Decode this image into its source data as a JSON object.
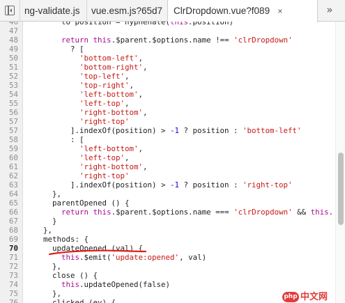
{
  "tabs": [
    {
      "label": "ng-validate.js",
      "active": false
    },
    {
      "label": "vue.esm.js?65d7",
      "active": false
    },
    {
      "label": "ClrDropdown.vue?f089",
      "active": true
    }
  ],
  "tab_close_glyph": "×",
  "more_tabs_glyph": "»",
  "icons": {
    "panel_toggle": "sidebar-toggle-icon",
    "close": "close-icon",
    "more": "chevrons-right-icon"
  },
  "colors": {
    "keyword": "#aa0d91",
    "string": "#c41a16",
    "number": "#1c00cf",
    "annotation": "#e0201c"
  },
  "code_lines": [
    {
      "n": "46",
      "text": "        to position = hyphenate(this.position)"
    },
    {
      "n": "47",
      "text": ""
    },
    {
      "n": "48",
      "text": "        return this.$parent.$options.name !== 'clrDropdown'"
    },
    {
      "n": "49",
      "text": "          ? ["
    },
    {
      "n": "50",
      "text": "            'bottom-left',"
    },
    {
      "n": "51",
      "text": "            'bottom-right',"
    },
    {
      "n": "52",
      "text": "            'top-left',"
    },
    {
      "n": "53",
      "text": "            'top-right',"
    },
    {
      "n": "54",
      "text": "            'left-bottom',"
    },
    {
      "n": "55",
      "text": "            'left-top',"
    },
    {
      "n": "56",
      "text": "            'right-bottom',"
    },
    {
      "n": "57",
      "text": "            'right-top'"
    },
    {
      "n": "57",
      "text": "          ].indexOf(position) > -1 ? position : 'bottom-left'"
    },
    {
      "n": "58",
      "text": "          : ["
    },
    {
      "n": "59",
      "text": "            'left-bottom',"
    },
    {
      "n": "60",
      "text": "            'left-top',"
    },
    {
      "n": "61",
      "text": "            'right-bottom',"
    },
    {
      "n": "62",
      "text": "            'right-top'"
    },
    {
      "n": "63",
      "text": "          ].indexOf(position) > -1 ? position : 'right-top'"
    },
    {
      "n": "64",
      "text": "      },"
    },
    {
      "n": "65",
      "text": "      parentOpened () {"
    },
    {
      "n": "66",
      "text": "        return this.$parent.$options.name === 'clrDropdown' && this."
    },
    {
      "n": "67",
      "text": "      }"
    },
    {
      "n": "68",
      "text": "    },"
    },
    {
      "n": "69",
      "text": "    methods: {"
    },
    {
      "n": "70",
      "text": "      updateOpened (val) {"
    },
    {
      "n": "71",
      "text": "        this.$emit('update:opened', val)"
    },
    {
      "n": "72",
      "text": "      },"
    },
    {
      "n": "73",
      "text": "      close () {"
    },
    {
      "n": "74",
      "text": "        this.updateOpened(false)"
    },
    {
      "n": "75",
      "text": "      },"
    },
    {
      "n": "76",
      "text": "      clicked (ev) {"
    }
  ],
  "watermark": {
    "badge": "php",
    "text": "中文网"
  }
}
